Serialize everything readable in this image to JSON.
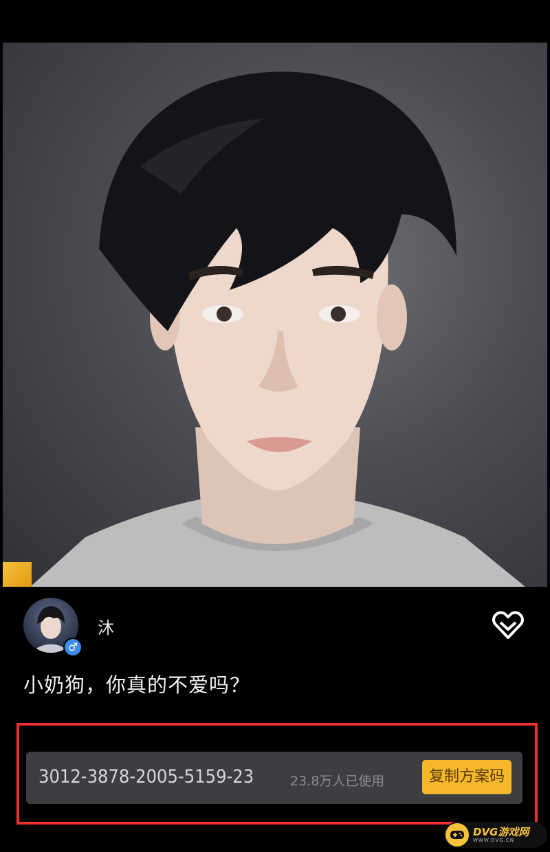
{
  "portrait": {
    "subject": "3D male character face, dark hair, grey t-shirt"
  },
  "post": {
    "username": "沐",
    "gender_symbol": "♂",
    "caption": "小奶狗，你真的不爱吗？"
  },
  "preset": {
    "code": "3012-3878-2005-5159-23",
    "usage": "23.8万人已使用",
    "copy_label": "复制方案码"
  },
  "watermark": {
    "title": "DVG游戏网",
    "subtitle": "WWW.DVG.CN"
  },
  "colors": {
    "accent": "#f5b82a",
    "highlight": "#f0302f",
    "bar": "#3d3e42"
  }
}
